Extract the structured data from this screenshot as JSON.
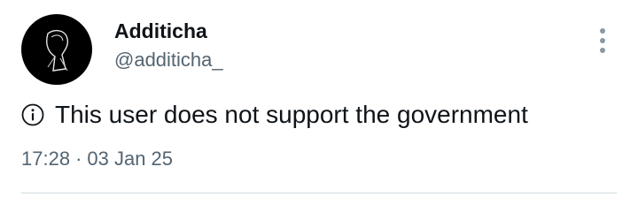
{
  "user": {
    "display_name": "Additicha",
    "handle": "@additicha_"
  },
  "notice": {
    "icon": "info-circle-icon",
    "text": "This user does not support the government"
  },
  "meta": {
    "time": "17:28",
    "separator": "·",
    "date": "03 Jan 25"
  },
  "icons": {
    "more": "more-vertical-icon",
    "avatar": "avatar-silhouette-icon"
  },
  "colors": {
    "primary_text": "#0f1419",
    "secondary_text": "#536471",
    "divider": "#cfd9de",
    "avatar_bg": "#000000"
  }
}
